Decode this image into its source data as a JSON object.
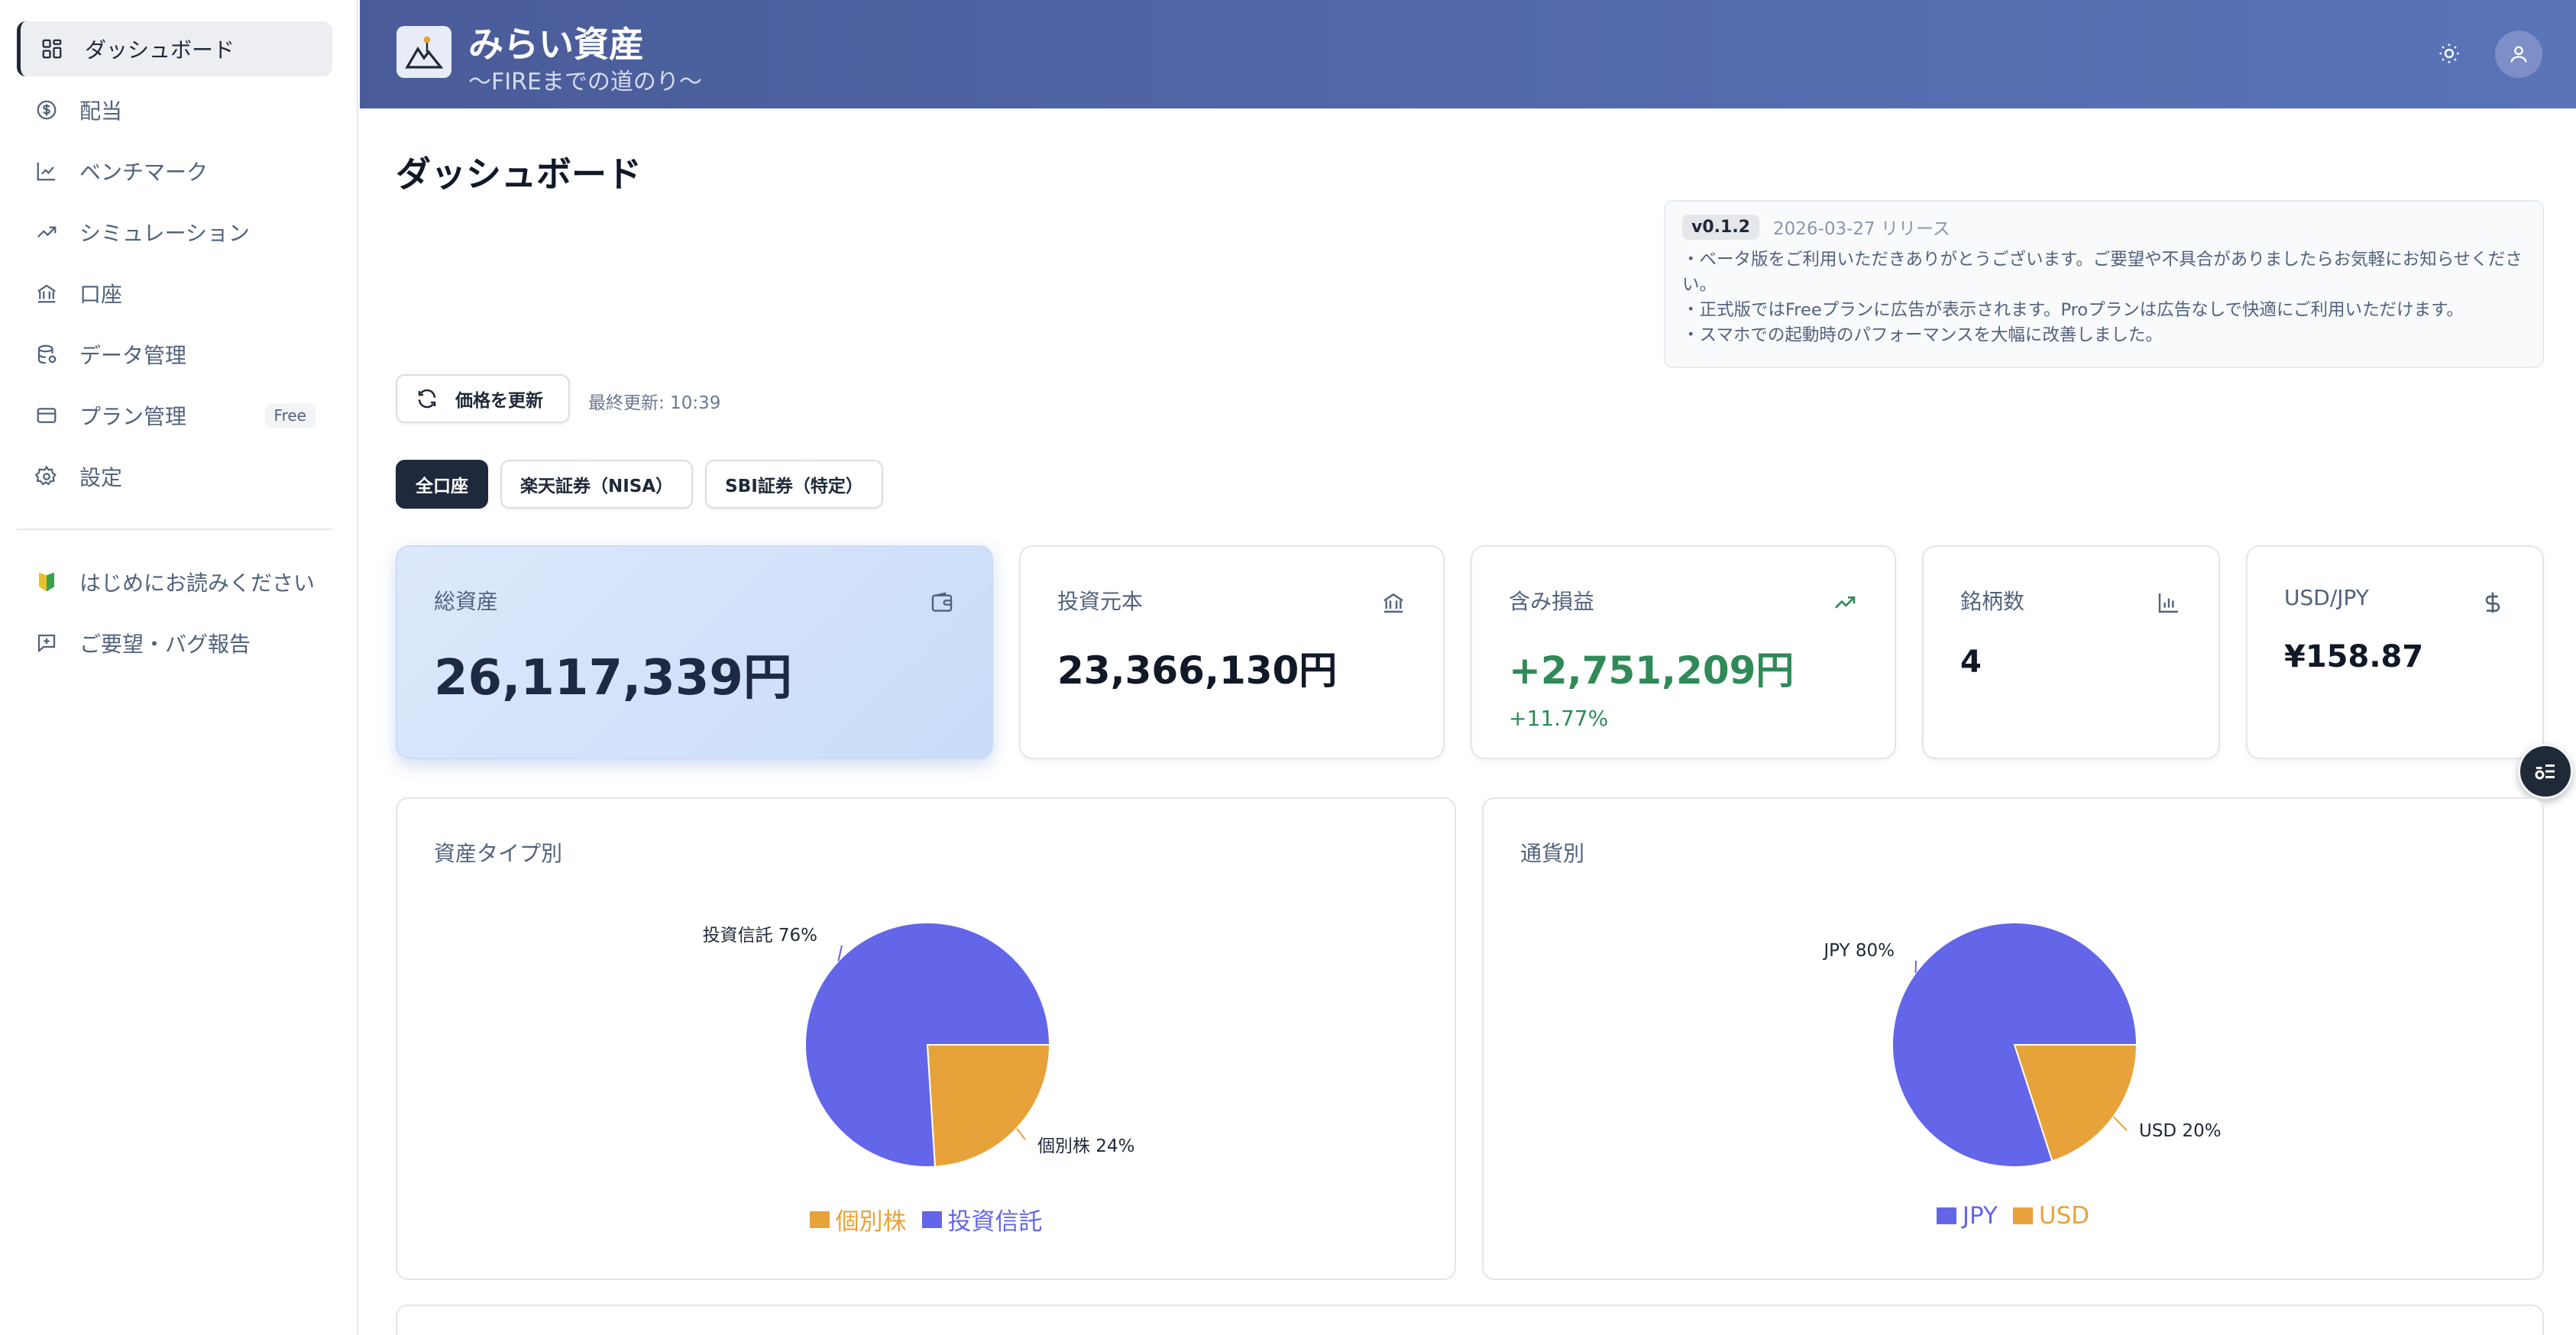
{
  "sidebar": {
    "items": [
      {
        "label": "ダッシュボード",
        "icon": "dashboard-icon"
      },
      {
        "label": "配当",
        "icon": "dollar-circle-icon"
      },
      {
        "label": "ベンチマーク",
        "icon": "line-chart-icon"
      },
      {
        "label": "シミュレーション",
        "icon": "trending-up-icon"
      },
      {
        "label": "口座",
        "icon": "bank-icon"
      },
      {
        "label": "データ管理",
        "icon": "database-icon"
      },
      {
        "label": "プラン管理",
        "icon": "credit-card-icon",
        "badge": "Free"
      },
      {
        "label": "設定",
        "icon": "gear-icon"
      }
    ],
    "extra": [
      {
        "label": "はじめにお読みください",
        "icon": "beginner-mark-icon"
      },
      {
        "label": "ご要望・バグ報告",
        "icon": "feedback-icon"
      }
    ]
  },
  "header": {
    "title": "みらい資産",
    "subtitle": "〜FIREまでの道のり〜"
  },
  "main": {
    "title": "ダッシュボード",
    "release": {
      "version": "v0.1.2",
      "date": "2026-03-27 リリース",
      "notes": [
        "・ベータ版をご利用いただきありがとうございます。ご要望や不具合がありましたらお気軽にお知らせください。",
        "・正式版ではFreeプランに広告が表示されます。Proプランは広告なしで快適にご利用いただけます。",
        "・スマホでの起動時のパフォーマンスを大幅に改善しました。"
      ]
    },
    "refresh_label": "価格を更新",
    "last_updated": "最終更新: 10:39",
    "tabs": [
      "全口座",
      "楽天証券（NISA）",
      "SBI証券（特定）"
    ],
    "cards": {
      "total": {
        "label": "総資産",
        "value": "26,117,339円"
      },
      "principal": {
        "label": "投資元本",
        "value": "23,366,130円"
      },
      "unrealized": {
        "label": "含み損益",
        "value": "+2,751,209円",
        "sub": "+11.77%"
      },
      "holdings": {
        "label": "銘柄数",
        "value": "4"
      },
      "fx": {
        "label": "USD/JPY",
        "value": "¥158.87"
      }
    }
  },
  "colors": {
    "primary_series": "#6366e8",
    "secondary_series": "#e8a23a",
    "positive": "#2f8a58"
  },
  "chart_data": [
    {
      "type": "pie",
      "title": "資産タイプ別",
      "slices": [
        {
          "name": "投資信託",
          "value": 76,
          "label": "投資信託 76%",
          "color": "#6366e8"
        },
        {
          "name": "個別株",
          "value": 24,
          "label": "個別株 24%",
          "color": "#e8a23a"
        }
      ],
      "legend": [
        "個別株",
        "投資信託"
      ]
    },
    {
      "type": "pie",
      "title": "通貨別",
      "slices": [
        {
          "name": "JPY",
          "value": 80,
          "label": "JPY 80%",
          "color": "#6366e8"
        },
        {
          "name": "USD",
          "value": 20,
          "label": "USD 20%",
          "color": "#e8a23a"
        }
      ],
      "legend": [
        "JPY",
        "USD"
      ]
    }
  ]
}
